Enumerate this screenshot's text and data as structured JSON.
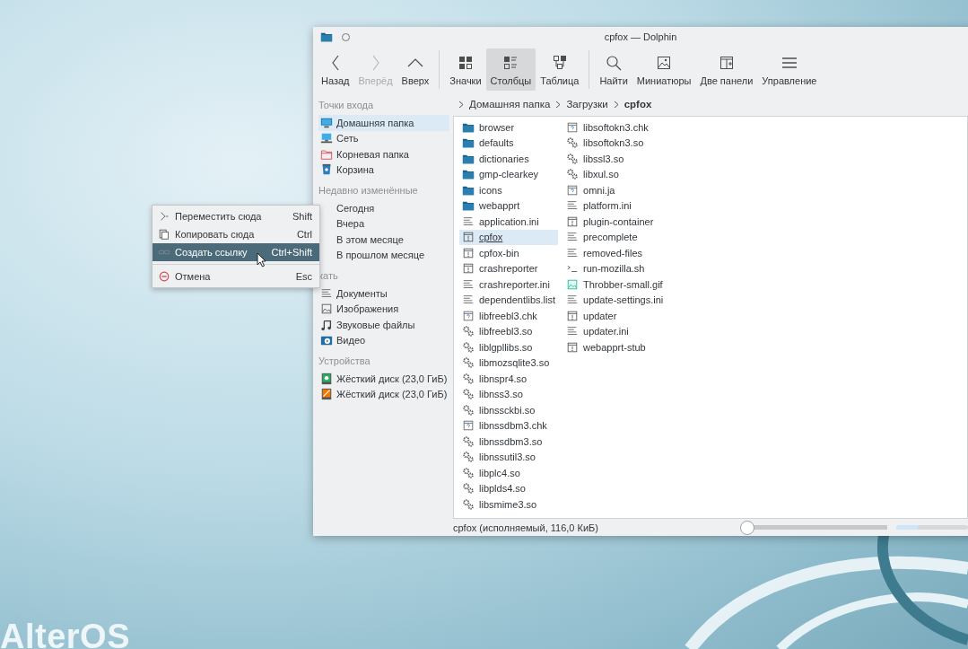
{
  "desktop": {
    "logo": "AlterOS"
  },
  "window": {
    "title": "cpfox — Dolphin"
  },
  "toolbar": [
    [
      {
        "label": "Назад",
        "kind": "back",
        "disabled": false,
        "selected": false
      },
      {
        "label": "Вперёд",
        "kind": "forward",
        "disabled": true,
        "selected": false
      },
      {
        "label": "Вверх",
        "kind": "up",
        "disabled": false,
        "selected": false
      }
    ],
    [
      {
        "label": "Значки",
        "kind": "icons",
        "disabled": false,
        "selected": false
      },
      {
        "label": "Столбцы",
        "kind": "compact",
        "disabled": false,
        "selected": true
      },
      {
        "label": "Таблица",
        "kind": "details",
        "disabled": false,
        "selected": false
      }
    ],
    [
      {
        "label": "Найти",
        "kind": "search",
        "disabled": false,
        "selected": false
      },
      {
        "label": "Миниатюры",
        "kind": "preview",
        "disabled": false,
        "selected": false
      },
      {
        "label": "Две панели",
        "kind": "split",
        "disabled": false,
        "selected": false
      },
      {
        "label": "Управление",
        "kind": "menu",
        "disabled": false,
        "selected": false
      }
    ]
  ],
  "sidebar": [
    {
      "title": "Точки входа",
      "items": [
        {
          "label": "Домашняя папка",
          "kind": "computer",
          "selected": true
        },
        {
          "label": "Сеть",
          "kind": "network",
          "selected": false
        },
        {
          "label": "Корневая папка",
          "kind": "root",
          "selected": false
        },
        {
          "label": "Корзина",
          "kind": "trash",
          "selected": false
        }
      ]
    },
    {
      "title": "Недавно изменённые",
      "items": [
        {
          "label": "Сегодня",
          "selected": false
        },
        {
          "label": "Вчера",
          "selected": false
        },
        {
          "label": "В этом месяце",
          "selected": false
        },
        {
          "label": "В прошлом месяце",
          "selected": false
        }
      ]
    },
    {
      "title": "кать",
      "items": [
        {
          "label": "Документы",
          "kind": "documents",
          "selected": false
        },
        {
          "label": "Изображения",
          "kind": "images",
          "selected": false
        },
        {
          "label": "Звуковые файлы",
          "kind": "music",
          "selected": false
        },
        {
          "label": "Видео",
          "kind": "video",
          "selected": false
        }
      ]
    },
    {
      "title": "Устройства",
      "items": [
        {
          "label": "Жёсткий диск (23,0 ГиБ)",
          "kind": "disk-green",
          "selected": false
        },
        {
          "label": "Жёсткий диск (23,0 ГиБ)",
          "kind": "disk-orange",
          "selected": false
        }
      ]
    }
  ],
  "breadcrumb": [
    {
      "label": "Домашняя папка",
      "current": false
    },
    {
      "label": "Загрузки",
      "current": false
    },
    {
      "label": "cpfox",
      "current": true
    }
  ],
  "files": [
    {
      "name": "browser",
      "kind": "folder",
      "selected": false
    },
    {
      "name": "defaults",
      "kind": "folder",
      "selected": false
    },
    {
      "name": "dictionaries",
      "kind": "folder",
      "selected": false
    },
    {
      "name": "gmp-clearkey",
      "kind": "folder",
      "selected": false
    },
    {
      "name": "icons",
      "kind": "folder",
      "selected": false
    },
    {
      "name": "webapprt",
      "kind": "folder",
      "selected": false
    },
    {
      "name": "application.ini",
      "kind": "text",
      "selected": false
    },
    {
      "name": "cpfox",
      "kind": "exec",
      "selected": true
    },
    {
      "name": "cpfox-bin",
      "kind": "exec",
      "selected": false
    },
    {
      "name": "crashreporter",
      "kind": "exec",
      "selected": false
    },
    {
      "name": "crashreporter.ini",
      "kind": "text",
      "selected": false
    },
    {
      "name": "dependentlibs.list",
      "kind": "text",
      "selected": false
    },
    {
      "name": "libfreebl3.chk",
      "kind": "unknown",
      "selected": false
    },
    {
      "name": "libfreebl3.so",
      "kind": "library",
      "selected": false
    },
    {
      "name": "liblgpllibs.so",
      "kind": "library",
      "selected": false
    },
    {
      "name": "libmozsqlite3.so",
      "kind": "library",
      "selected": false
    },
    {
      "name": "libnspr4.so",
      "kind": "library",
      "selected": false
    },
    {
      "name": "libnss3.so",
      "kind": "library",
      "selected": false
    },
    {
      "name": "libnssckbi.so",
      "kind": "library",
      "selected": false
    },
    {
      "name": "libnssdbm3.chk",
      "kind": "unknown",
      "selected": false
    },
    {
      "name": "libnssdbm3.so",
      "kind": "library",
      "selected": false
    },
    {
      "name": "libnssutil3.so",
      "kind": "library",
      "selected": false
    },
    {
      "name": "libplc4.so",
      "kind": "library",
      "selected": false
    },
    {
      "name": "libplds4.so",
      "kind": "library",
      "selected": false
    },
    {
      "name": "libsmime3.so",
      "kind": "library",
      "selected": false
    },
    {
      "name": "libsoftokn3.chk",
      "kind": "unknown",
      "selected": false
    },
    {
      "name": "libsoftokn3.so",
      "kind": "library",
      "selected": false
    },
    {
      "name": "libssl3.so",
      "kind": "library",
      "selected": false
    },
    {
      "name": "libxul.so",
      "kind": "library",
      "selected": false
    },
    {
      "name": "omni.ja",
      "kind": "unknown",
      "selected": false
    },
    {
      "name": "platform.ini",
      "kind": "text",
      "selected": false
    },
    {
      "name": "plugin-container",
      "kind": "exec",
      "selected": false
    },
    {
      "name": "precomplete",
      "kind": "text",
      "selected": false
    },
    {
      "name": "removed-files",
      "kind": "text",
      "selected": false
    },
    {
      "name": "run-mozilla.sh",
      "kind": "script",
      "selected": false
    },
    {
      "name": "Throbber-small.gif",
      "kind": "image",
      "selected": false
    },
    {
      "name": "update-settings.ini",
      "kind": "text",
      "selected": false
    },
    {
      "name": "updater",
      "kind": "exec",
      "selected": false
    },
    {
      "name": "updater.ini",
      "kind": "text",
      "selected": false
    },
    {
      "name": "webapprt-stub",
      "kind": "exec",
      "selected": false
    }
  ],
  "status_bar": {
    "text": "cpfox (исполняемый, 116,0 КиБ)",
    "zoom": {
      "level": 0.02
    }
  },
  "context_menu": [
    {
      "label": "Переместить сюда",
      "shortcut": "Shift",
      "kind": "move",
      "selected": false,
      "separator_before": false
    },
    {
      "label": "Копировать сюда",
      "shortcut": "Ctrl",
      "kind": "copy",
      "selected": false,
      "separator_before": false
    },
    {
      "label": "Создать ссылку",
      "shortcut": "Ctrl+Shift",
      "kind": "link",
      "selected": true,
      "separator_before": false
    },
    {
      "label": "Отмена",
      "shortcut": "Esc",
      "kind": "cancel",
      "selected": false,
      "separator_before": true
    }
  ]
}
